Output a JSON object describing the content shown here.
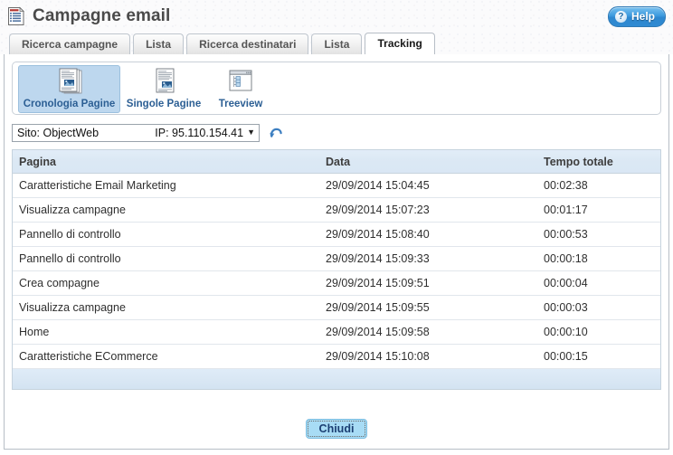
{
  "titlebar": {
    "icon": "document-list-icon",
    "title": "Campagne email",
    "help_label": "Help",
    "help_icon": "question-mark-icon"
  },
  "tabs": [
    {
      "label": "Ricerca campagne",
      "active": false
    },
    {
      "label": "Lista",
      "active": false
    },
    {
      "label": "Ricerca destinatari",
      "active": false
    },
    {
      "label": "Lista",
      "active": false
    },
    {
      "label": "Tracking",
      "active": true
    }
  ],
  "toolbar": {
    "buttons": [
      {
        "label": "Cronologia Pagine",
        "icon": "stacked-pages-icon",
        "selected": true
      },
      {
        "label": "Singole Pagine",
        "icon": "single-page-icon",
        "selected": false
      },
      {
        "label": "Treeview",
        "icon": "treeview-window-icon",
        "selected": false
      }
    ]
  },
  "filter": {
    "site_label": "Sito: ObjectWeb",
    "ip_label": "IP: 95.110.154.41",
    "arrow": "▼",
    "refresh_icon": "refresh-undo-arrow-icon"
  },
  "table": {
    "columns": [
      "Pagina",
      "Data",
      "Tempo totale"
    ],
    "rows": [
      {
        "pagina": "Caratteristiche Email Marketing",
        "data": "29/09/2014 15:04:45",
        "tempo": "00:02:38"
      },
      {
        "pagina": "Visualizza campagne",
        "data": "29/09/2014 15:07:23",
        "tempo": "00:01:17"
      },
      {
        "pagina": "Pannello di controllo",
        "data": "29/09/2014 15:08:40",
        "tempo": "00:00:53"
      },
      {
        "pagina": "Pannello di controllo",
        "data": "29/09/2014 15:09:33",
        "tempo": "00:00:18"
      },
      {
        "pagina": "Crea compagne",
        "data": "29/09/2014 15:09:51",
        "tempo": "00:00:04"
      },
      {
        "pagina": "Visualizza campagne",
        "data": "29/09/2014 15:09:55",
        "tempo": "00:00:03"
      },
      {
        "pagina": "Home",
        "data": "29/09/2014 15:09:58",
        "tempo": "00:00:10"
      },
      {
        "pagina": "Caratteristiche ECommerce",
        "data": "29/09/2014 15:10:08",
        "tempo": "00:00:15"
      }
    ]
  },
  "footer": {
    "close_label": "Chiudi"
  },
  "colors": {
    "accent_blue": "#2f8ad2",
    "tool_label_blue": "#2c5f94",
    "table_header_blue": "#dbe8f4",
    "selection_blue": "#bdd7ee",
    "close_button_blue": "#a8dcf5",
    "panel_border": "#b7bec6"
  }
}
